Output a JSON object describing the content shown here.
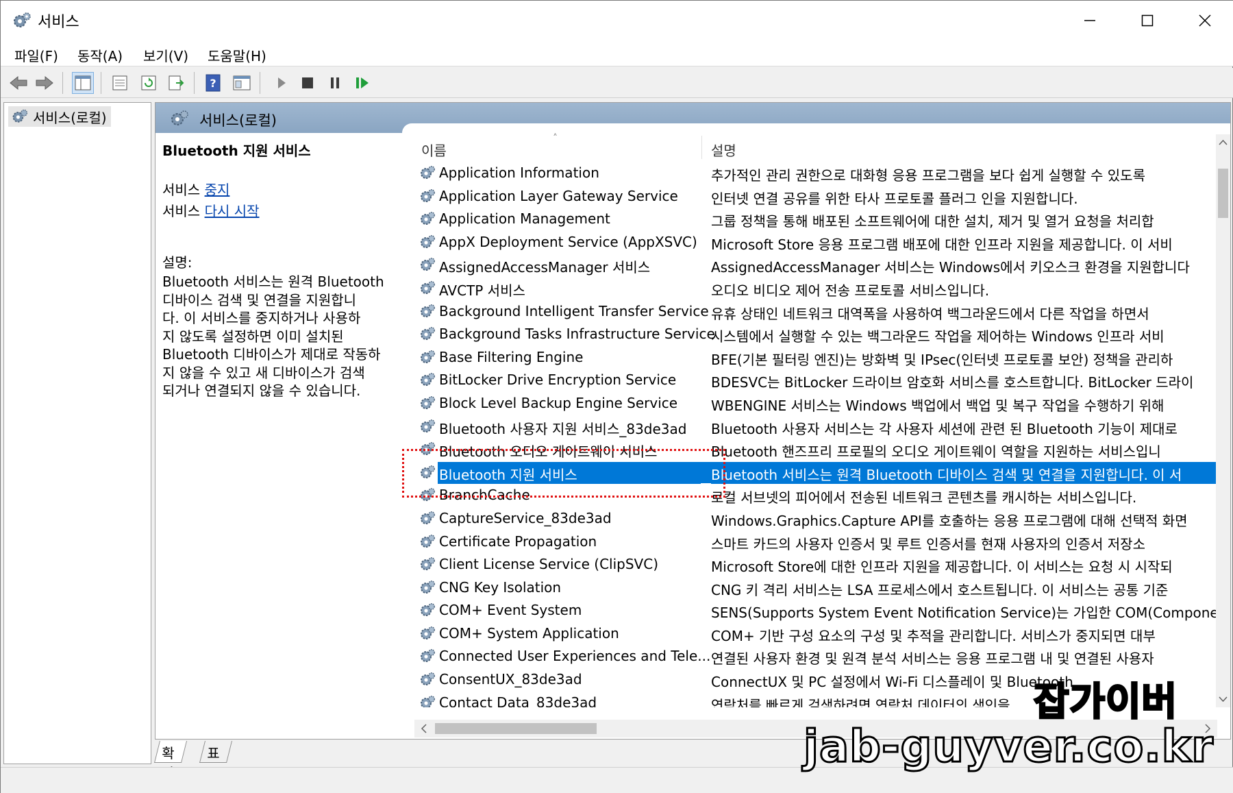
{
  "window": {
    "title": "서비스",
    "minimize_label": "—",
    "maximize_label": "☐",
    "close_label": "✕"
  },
  "menu": {
    "items": [
      {
        "label": "파일(F)"
      },
      {
        "label": "동작(A)"
      },
      {
        "label": "보기(V)"
      },
      {
        "label": "도움말(H)"
      }
    ]
  },
  "toolbar": {
    "icons": [
      "back-icon",
      "forward-icon",
      "show-hide-tree-icon",
      "properties-icon",
      "refresh-icon",
      "export-list-icon",
      "help-icon",
      "view-icon",
      "start-icon",
      "stop-icon",
      "pause-icon",
      "resume-icon"
    ]
  },
  "tree": {
    "root_label": "서비스(로컬)"
  },
  "main": {
    "header_title": "서비스(로컬)",
    "selected_service": {
      "title": "Bluetooth 지원 서비스",
      "action_stop_prefix": "서비스 ",
      "action_stop_link": "중지",
      "action_restart_prefix": "서비스 ",
      "action_restart_link": "다시 시작",
      "desc_label": "설명:",
      "desc_lines": [
        "Bluetooth 서비스는 원격 Bluetooth",
        "디바이스 검색 및 연결을 지원합니",
        "다. 이 서비스를 중지하거나 사용하",
        "지 않도록 설정하면 이미 설치된",
        "Bluetooth 디바이스가 제대로 작동하",
        "지 않을 수 있고 새 디바이스가 검색",
        "되거나 연결되지 않을 수 있습니다."
      ]
    },
    "columns": {
      "name": "이름",
      "description": "설명"
    },
    "rows": [
      {
        "name": "Application Information",
        "desc": "추가적인 관리 권한으로 대화형 응용 프로그램을 보다 쉽게 실행할 수 있도록"
      },
      {
        "name": "Application Layer Gateway Service",
        "desc": "인터넷 연결 공유를 위한 타사 프로토콜 플러그 인을 지원합니다."
      },
      {
        "name": "Application Management",
        "desc": "그룹 정책을 통해 배포된 소프트웨어에 대한 설치, 제거 및 열거 요청을 처리합"
      },
      {
        "name": "AppX Deployment Service (AppXSVC)",
        "desc": "Microsoft Store 응용 프로그램 배포에 대한 인프라 지원을 제공합니다. 이 서비"
      },
      {
        "name": "AssignedAccessManager 서비스",
        "desc": "AssignedAccessManager 서비스는 Windows에서 키오스크 환경을 지원합니다"
      },
      {
        "name": "AVCTP 서비스",
        "desc": "오디오 비디오 제어 전송 프로토콜 서비스입니다."
      },
      {
        "name": "Background Intelligent Transfer Service",
        "desc": "유휴 상태인 네트워크 대역폭을 사용하여 백그라운드에서 다른 작업을 하면서"
      },
      {
        "name": "Background Tasks Infrastructure Service",
        "desc": "시스템에서 실행할 수 있는 백그라운드 작업을 제어하는 Windows 인프라 서비"
      },
      {
        "name": "Base Filtering Engine",
        "desc": "BFE(기본 필터링 엔진)는 방화벽 및 IPsec(인터넷 프로토콜 보안) 정책을 관리하"
      },
      {
        "name": "BitLocker Drive Encryption Service",
        "desc": "BDESVC는 BitLocker 드라이브 암호화 서비스를 호스트합니다. BitLocker 드라이"
      },
      {
        "name": "Block Level Backup Engine Service",
        "desc": "WBENGINE 서비스는 Windows 백업에서 백업 및 복구 작업을 수행하기 위해"
      },
      {
        "name": "Bluetooth 사용자 지원 서비스_83de3ad",
        "desc": "Bluetooth 사용자 서비스는 각 사용자 세션에 관련 된 Bluetooth 기능이 제대로"
      },
      {
        "name": "Bluetooth 오디오 게이트웨이 서비스",
        "desc": "Bluetooth 핸즈프리 프로필의 오디오 게이트웨이 역할을 지원하는 서비스입니"
      },
      {
        "name": "Bluetooth 지원 서비스",
        "desc": "Bluetooth 서비스는 원격 Bluetooth 디바이스 검색 및 연결을 지원합니다. 이 서",
        "selected": true
      },
      {
        "name": "BranchCache",
        "desc": "로컬 서브넷의 피어에서 전송된 네트워크 콘텐츠를 캐시하는 서비스입니다."
      },
      {
        "name": "CaptureService_83de3ad",
        "desc": "Windows.Graphics.Capture API를 호출하는 응용 프로그램에 대해 선택적 화면"
      },
      {
        "name": "Certificate Propagation",
        "desc": "스마트 카드의 사용자 인증서 및 루트 인증서를 현재 사용자의 인증서 저장소"
      },
      {
        "name": "Client License Service (ClipSVC)",
        "desc": "Microsoft Store에 대한 인프라 지원을 제공합니다. 이 서비스는 요청 시 시작되"
      },
      {
        "name": "CNG Key Isolation",
        "desc": "CNG 키 격리 서비스는 LSA 프로세스에서 호스트됩니다. 이 서비스는 공통 기준"
      },
      {
        "name": "COM+ Event System",
        "desc": "SENS(Supports System Event Notification Service)는 가입한 COM(Component"
      },
      {
        "name": "COM+ System Application",
        "desc": "COM+ 기반 구성 요소의 구성 및 추적을 관리합니다. 서비스가 중지되면 대부"
      },
      {
        "name": "Connected User Experiences and Tele...",
        "desc": "연결된 사용자 환경 및 원격 분석 서비스는 응용 프로그램 내 및 연결된 사용자"
      },
      {
        "name": "ConsentUX_83de3ad",
        "desc": "ConnectUX 및 PC 설정에서 Wi-Fi 디스플레이 및 Bluetooth"
      },
      {
        "name": "Contact Data_83de3ad",
        "desc": "연락처를 빠르게 검색하려면 연락처 데이터의 색인을"
      }
    ]
  },
  "tabs": [
    {
      "label": "확장"
    },
    {
      "label": "표준"
    }
  ],
  "watermark": {
    "line1": "잡가이버",
    "line2": "jab-guyver.co.kr"
  },
  "colors": {
    "selection": "#0078d7",
    "header_band": "#8aa5c2",
    "link": "#0645ad",
    "highlight_box": "#e01010"
  }
}
